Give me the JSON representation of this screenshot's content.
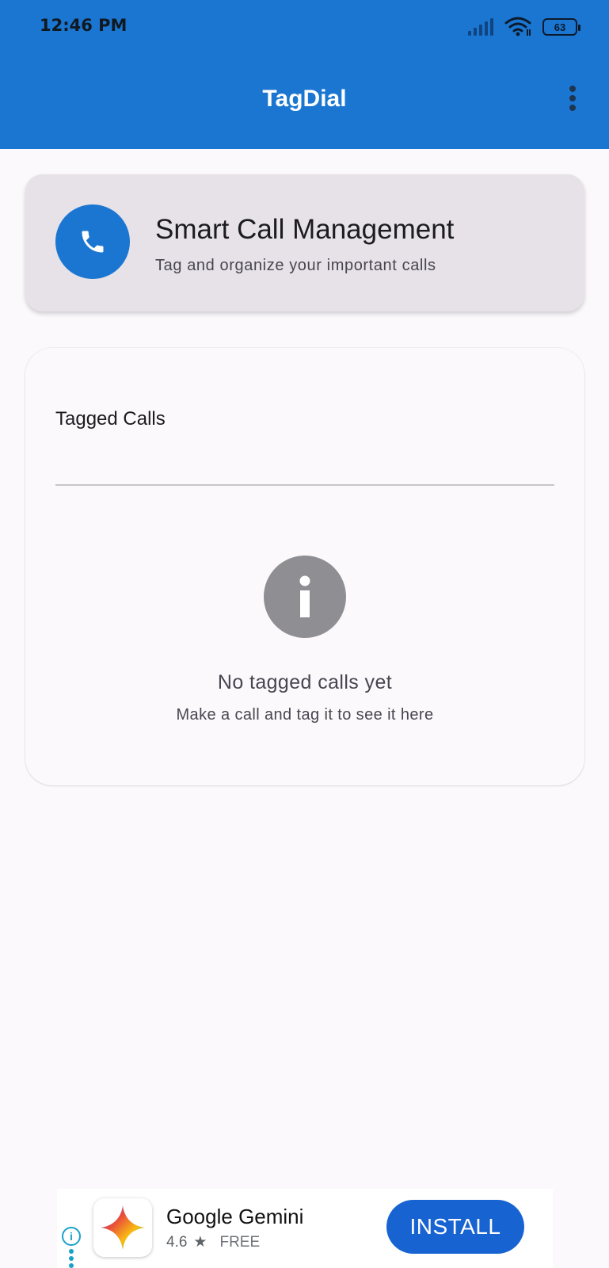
{
  "status_bar": {
    "time": "12:46 PM",
    "battery": "63",
    "icons": [
      "signal-icon",
      "wifi-icon",
      "battery-icon"
    ]
  },
  "app_bar": {
    "title": "TagDial",
    "menu_icon": "more-vert-icon"
  },
  "header_card": {
    "icon": "phone-icon",
    "title": "Smart Call Management",
    "subtitle": "Tag and organize your important calls"
  },
  "tagged_calls": {
    "title": "Tagged Calls",
    "empty_icon": "info-icon",
    "empty_title": "No tagged calls yet",
    "empty_subtitle": "Make a call and tag it to see it here"
  },
  "ad": {
    "app_name": "Google Gemini",
    "rating": "4.6",
    "rating_icon": "star-icon",
    "price": "FREE",
    "button": "INSTALL",
    "info_icon": "ad-info-icon",
    "colors": {
      "button": "#1763d1",
      "info": "#18a2c8"
    }
  },
  "colors": {
    "primary": "#1b76d2",
    "background": "#fcf9fd",
    "header_card": "#e6e2e8",
    "empty_icon": "#8e8e93"
  }
}
